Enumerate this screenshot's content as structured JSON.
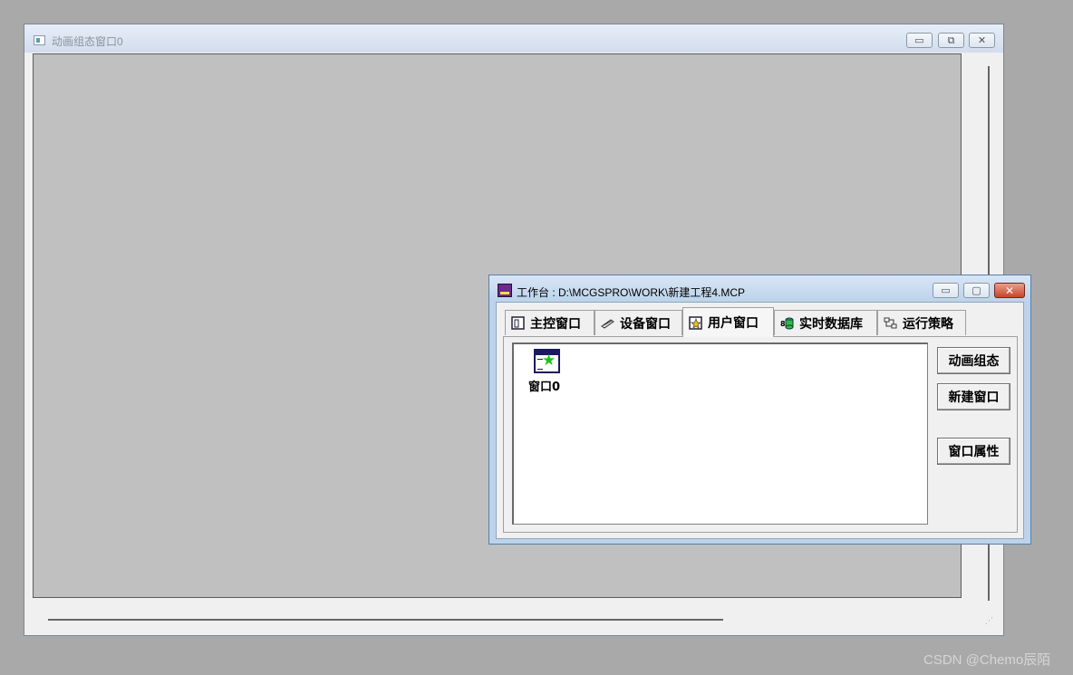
{
  "animation_window": {
    "title": "动画组态窗口0",
    "minimize_glyph": "▭",
    "maximize_glyph": "⧉",
    "close_glyph": "✕"
  },
  "workbench": {
    "title": "工作台 : D:\\MCGSPRO\\WORK\\新建工程4.MCP",
    "minimize_glyph": "▭",
    "maximize_glyph": "▢",
    "close_glyph": "✕",
    "tabs": [
      {
        "label": "主控窗口",
        "icon": "main-window-icon"
      },
      {
        "label": "设备窗口",
        "icon": "device-icon"
      },
      {
        "label": "用户窗口",
        "icon": "user-window-icon",
        "active": true
      },
      {
        "label": "实时数据库",
        "icon": "database-icon"
      },
      {
        "label": "运行策略",
        "icon": "strategy-icon"
      }
    ],
    "windows_list": [
      {
        "label": "窗口0",
        "icon": "window-star-icon"
      }
    ],
    "buttons": {
      "animate": "动画组态",
      "new_window": "新建窗口",
      "properties": "窗口属性"
    }
  },
  "watermark": "CSDN @Chemo辰陌"
}
